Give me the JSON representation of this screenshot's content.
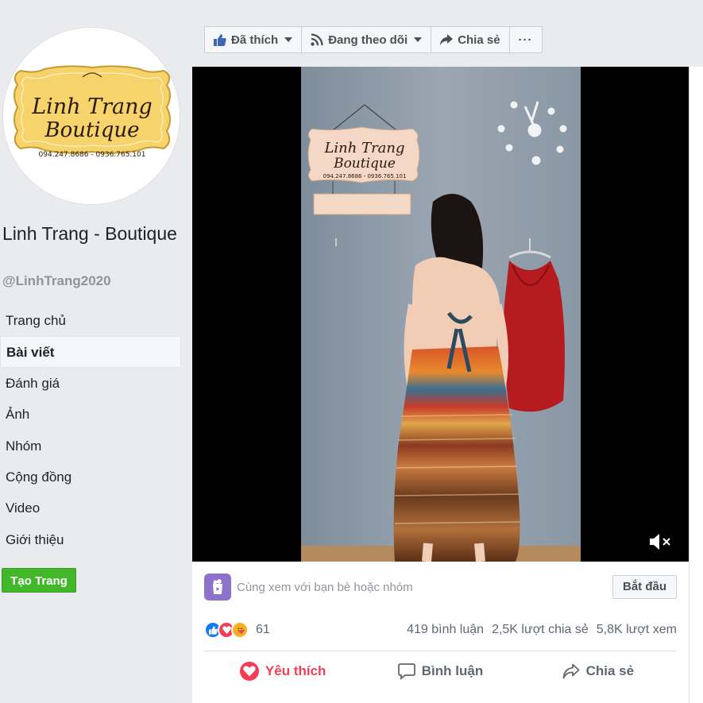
{
  "page": {
    "logo_line1": "Linh Trang",
    "logo_line2": "Boutique",
    "logo_phone": "094.247.8686 - 0936.765.101",
    "name": "Linh Trang - Boutique",
    "handle": "@LinhTrang2020"
  },
  "nav": {
    "items": [
      {
        "label": "Trang chủ"
      },
      {
        "label": "Bài viết"
      },
      {
        "label": "Đánh giá"
      },
      {
        "label": "Ảnh"
      },
      {
        "label": "Nhóm"
      },
      {
        "label": "Cộng đồng"
      },
      {
        "label": "Video"
      },
      {
        "label": "Giới thiệu"
      }
    ],
    "active_index": 1,
    "create_page": "Tạo Trang"
  },
  "actionbar": {
    "liked": "Đã thích",
    "following": "Đang theo dõi",
    "share": "Chia sẻ",
    "more": "···"
  },
  "video": {
    "sign_line1": "Linh Trang",
    "sign_line2": "Boutique",
    "sign_phone": "094.247.8686 - 0936.765.101"
  },
  "watch": {
    "text": "Cùng xem với bạn bè hoặc nhóm",
    "button": "Bắt đầu"
  },
  "stats": {
    "reactions": "61",
    "comments": "419 bình luận",
    "shares": "2,5K lượt chia sẻ",
    "views": "5,8K lượt xem"
  },
  "post_actions": {
    "like": "Yêu thích",
    "comment": "Bình luận",
    "share": "Chia sẻ"
  },
  "colors": {
    "accent_green": "#42b72a",
    "love_red": "#f33e58",
    "fb_blue": "#4267b2",
    "logo_gold": "#f7d36b"
  }
}
